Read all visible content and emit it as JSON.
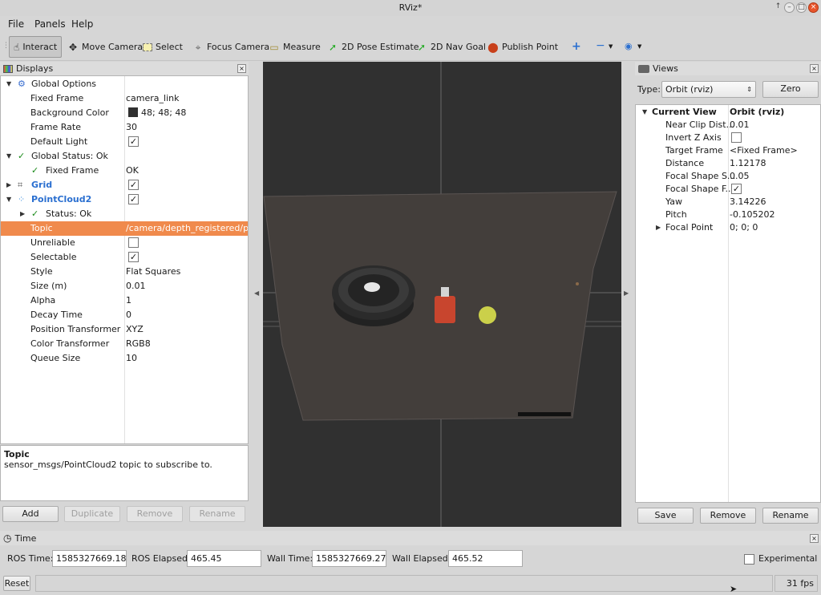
{
  "window": {
    "title": "RViz*"
  },
  "menu": [
    "File",
    "Panels",
    "Help"
  ],
  "toolbar": {
    "interact": "Interact",
    "move_camera": "Move Camera",
    "select": "Select",
    "focus_camera": "Focus Camera",
    "measure": "Measure",
    "pose_estimate": "2D Pose Estimate",
    "nav_goal": "2D Nav Goal",
    "publish_point": "Publish Point"
  },
  "displays": {
    "title": "Displays",
    "global_options": "Global Options",
    "fixed_frame_label": "Fixed Frame",
    "fixed_frame_value": "camera_link",
    "bg_color_label": "Background Color",
    "bg_color_value": "48; 48; 48",
    "bg_color_hex": "#303030",
    "frame_rate_label": "Frame Rate",
    "frame_rate_value": "30",
    "default_light_label": "Default Light",
    "global_status": "Global Status: Ok",
    "fixed_frame_status_label": "Fixed Frame",
    "fixed_frame_status_value": "OK",
    "grid": "Grid",
    "pointcloud2": "PointCloud2",
    "status": "Status: Ok",
    "topic_label": "Topic",
    "topic_value": "/camera/depth_registered/p...",
    "unreliable_label": "Unreliable",
    "selectable_label": "Selectable",
    "style_label": "Style",
    "style_value": "Flat Squares",
    "size_label": "Size (m)",
    "size_value": "0.01",
    "alpha_label": "Alpha",
    "alpha_value": "1",
    "decay_label": "Decay Time",
    "decay_value": "0",
    "pos_tf_label": "Position Transformer",
    "pos_tf_value": "XYZ",
    "color_tf_label": "Color Transformer",
    "color_tf_value": "RGB8",
    "queue_label": "Queue Size",
    "queue_value": "10",
    "desc_title": "Topic",
    "desc_text": "sensor_msgs/PointCloud2 topic to subscribe to.",
    "add": "Add",
    "duplicate": "Duplicate",
    "remove": "Remove",
    "rename": "Rename"
  },
  "views": {
    "title": "Views",
    "type_label": "Type:",
    "type_value": "Orbit (rviz)",
    "zero": "Zero",
    "current_view_label": "Current View",
    "current_view_value": "Orbit (rviz)",
    "near_clip_label": "Near Clip Dist...",
    "near_clip_value": "0.01",
    "invert_z_label": "Invert Z Axis",
    "target_frame_label": "Target Frame",
    "target_frame_value": "<Fixed Frame>",
    "distance_label": "Distance",
    "distance_value": "1.12178",
    "focal_size_label": "Focal Shape S...",
    "focal_size_value": "0.05",
    "focal_fixed_label": "Focal Shape F...",
    "yaw_label": "Yaw",
    "yaw_value": "3.14226",
    "pitch_label": "Pitch",
    "pitch_value": "-0.105202",
    "focal_point_label": "Focal Point",
    "focal_point_value": "0; 0; 0",
    "save": "Save",
    "remove": "Remove",
    "rename": "Rename"
  },
  "time": {
    "title": "Time",
    "ros_time_label": "ROS Time:",
    "ros_time": "1585327669.18",
    "ros_elapsed_label": "ROS Elapsed:",
    "ros_elapsed": "465.45",
    "wall_time_label": "Wall Time:",
    "wall_time": "1585327669.27",
    "wall_elapsed_label": "Wall Elapsed:",
    "wall_elapsed": "465.52",
    "experimental": "Experimental"
  },
  "status": {
    "reset": "Reset",
    "fps": "31 fps"
  }
}
